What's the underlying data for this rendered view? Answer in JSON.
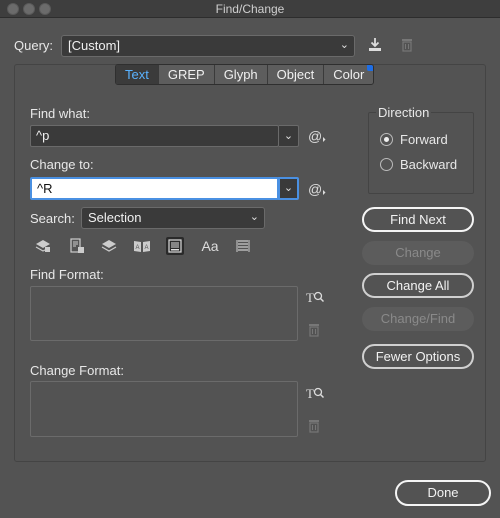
{
  "window": {
    "title": "Find/Change"
  },
  "query": {
    "label": "Query:",
    "value": "[Custom]"
  },
  "tabs": [
    {
      "label": "Text",
      "active": true
    },
    {
      "label": "GREP",
      "active": false
    },
    {
      "label": "Glyph",
      "active": false
    },
    {
      "label": "Object",
      "active": false
    },
    {
      "label": "Color",
      "active": false
    }
  ],
  "find": {
    "label": "Find what:",
    "value": "^p"
  },
  "change": {
    "label": "Change to:",
    "value": "^R"
  },
  "search": {
    "label": "Search:",
    "value": "Selection"
  },
  "find_format": {
    "label": "Find Format:"
  },
  "change_format": {
    "label": "Change Format:"
  },
  "direction": {
    "label": "Direction",
    "options": [
      {
        "label": "Forward",
        "selected": true
      },
      {
        "label": "Backward",
        "selected": false
      }
    ]
  },
  "buttons": {
    "find_next": "Find Next",
    "change": "Change",
    "change_all": "Change All",
    "change_find": "Change/Find",
    "fewer_options": "Fewer Options",
    "done": "Done"
  },
  "search_options_icons": [
    "include-locked-layers-icon",
    "include-locked-stories-icon",
    "include-hidden-layers-icon",
    "include-master-pages-icon",
    "include-footnotes-icon",
    "case-sensitive-icon",
    "whole-word-icon"
  ],
  "option_glyphs": {
    "case_sensitive": "Aa"
  },
  "colors": {
    "accent": "#4a90e2",
    "active_tab_text": "#5ab2ff",
    "badge": "#1e6ee6"
  }
}
